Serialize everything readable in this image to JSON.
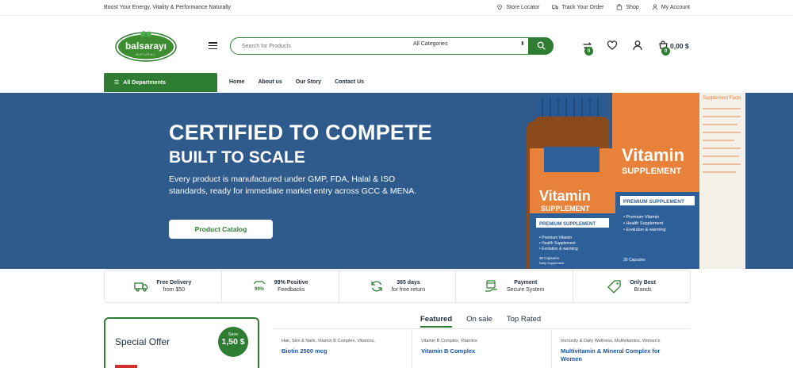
{
  "topbar": {
    "tagline": "Boost Your Energy, Vitality & Performance Naturally",
    "links": [
      {
        "label": "Store Locator",
        "icon": "map-pin-icon"
      },
      {
        "label": "Track Your Order",
        "icon": "truck-icon"
      },
      {
        "label": "Shop",
        "icon": "shopping-bag-icon"
      },
      {
        "label": "My Account",
        "icon": "user-icon"
      }
    ]
  },
  "header": {
    "logo_text": "balsarayı",
    "logo_subtext": "NATURAL",
    "search": {
      "placeholder": "Search for Products",
      "category_selected": "All Categories"
    },
    "compare_count": "0",
    "cart_count": "0",
    "cart_total": "0,00 $"
  },
  "nav": {
    "departments_label": "All Departments",
    "links": [
      "Home",
      "About us",
      "Our Story",
      "Contact Us"
    ]
  },
  "hero": {
    "title": "CERTIFIED TO COMPETE",
    "subtitle": "BUILT TO SCALE",
    "body": "Every product is manufactured under GMP, FDA, Halal & ISO standards, ready for immediate market entry across GCC & MENA.",
    "cta": "Product Catalog",
    "bottle_brand": "Vitamin",
    "bottle_sub": "SUPPLEMENT",
    "bottle_badge": "PREMIUM SUPPLEMENT",
    "bottle_lines": [
      "• Premium Vitamin",
      "• Health Supplement",
      "• Evolution & warming"
    ],
    "bottle_count": "30 Capsules",
    "bottle_count_sub": "Daily Supplement",
    "box_panel_title": "Supplement Facts",
    "colors": {
      "background": "#2f5a8c",
      "bottle_orange": "#e8813a",
      "bottle_blue": "#2d5f99"
    }
  },
  "features": [
    {
      "title": "Free Delivery",
      "subtitle": "from $50",
      "icon": "truck-icon"
    },
    {
      "title": "99% Positive",
      "subtitle": "Feedbacks",
      "icon": "rating-badge-icon",
      "icon_text": "99%"
    },
    {
      "title": "365 days",
      "subtitle": "for free return",
      "icon": "refresh-icon"
    },
    {
      "title": "Payment",
      "subtitle": "Secure System",
      "icon": "secure-payment-icon"
    },
    {
      "title": "Only Best",
      "subtitle": "Brands",
      "icon": "tag-icon"
    }
  ],
  "special_offer": {
    "title": "Special Offer",
    "save_label": "Save",
    "save_amount": "1,50 $"
  },
  "product_tabs": [
    "Featured",
    "On sale",
    "Top Rated"
  ],
  "products": [
    {
      "categories": "Hair, Skin & Nails, Vitamin B Complex, Vitamins,",
      "name": "Biotin 2500 mcg"
    },
    {
      "categories": "Vitamin B Complex, Vitamins",
      "name": "Vitamin B Complex"
    },
    {
      "categories": "Immunity & Daily Wellness, Multivitamins, Women's",
      "name": "Multivitamin & Mineral Complex for Women"
    }
  ],
  "colors": {
    "brand_green": "#2e7d32",
    "link_blue": "#1a55a8"
  }
}
